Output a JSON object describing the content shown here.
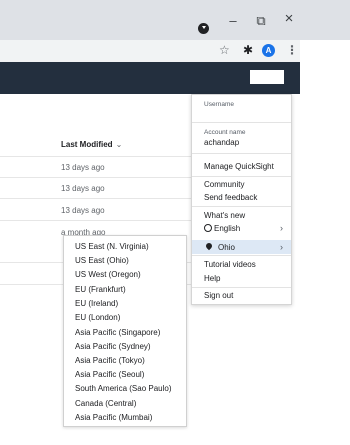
{
  "window": {
    "minimize": "–",
    "maximize": "⧉",
    "close": "×"
  },
  "toolbar": {
    "star_icon": "☆",
    "extensions_icon": "✱",
    "avatar_letter": "A",
    "menu_icon": "⋮"
  },
  "table": {
    "column_header": "Last Modified",
    "sort_icon": "⌄",
    "rows": [
      "13 days ago",
      "13 days ago",
      "13 days ago",
      "a month ago"
    ]
  },
  "account_menu": {
    "username_label": "Username",
    "account_name_label": "Account name",
    "account_name": "achandap",
    "manage": "Manage QuickSight",
    "community": "Community",
    "feedback": "Send feedback",
    "whats_new": "What's new",
    "language": "English",
    "region": "Ohio",
    "tutorials": "Tutorial videos",
    "help": "Help",
    "signout": "Sign out",
    "arrow": "›"
  },
  "regions": [
    "US East (N. Virginia)",
    "US East (Ohio)",
    "US West (Oregon)",
    "EU (Frankfurt)",
    "EU (Ireland)",
    "EU (London)",
    "Asia Pacific (Singapore)",
    "Asia Pacific (Sydney)",
    "Asia Pacific (Tokyo)",
    "Asia Pacific (Seoul)",
    "South America (Sao Paulo)",
    "Canada (Central)",
    "Asia Pacific (Mumbai)"
  ]
}
